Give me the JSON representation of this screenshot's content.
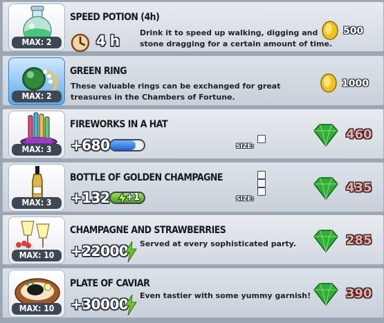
{
  "items": [
    {
      "title": "SPEED POTION (4h)",
      "max": "MAX: 2",
      "duration": "4 h",
      "description": "Drink it to speed up walking, digging and\nstone dragging for a certain amount of time.",
      "price": "500",
      "currency": "coin",
      "image": "potion-flask-icon"
    },
    {
      "title": "GREEN RING",
      "max": "MAX: 2",
      "description": "These valuable rings can be exchanged for great\ntreasures in the Chambers of Fortune.",
      "price": "1000",
      "currency": "coin",
      "image": "green-ring-icon"
    },
    {
      "title": "FIREWORKS IN A HAT",
      "max": "MAX: 3",
      "value": "+680",
      "bar_fill": 0.75,
      "size_label": "SIZE:",
      "size_cells": 1,
      "price": "460",
      "currency": "gem",
      "image": "fireworks-hat-icon"
    },
    {
      "title": "BOTTLE OF GOLDEN CHAMPAGNE",
      "max": "MAX: 3",
      "value": "+132",
      "energy_bonus": "+1",
      "size_label": "SIZE:",
      "size_cells": 3,
      "price": "435",
      "currency": "gem",
      "image": "champagne-bottle-icon"
    },
    {
      "title": "CHAMPAGNE AND STRAWBERRIES",
      "max": "MAX: 10",
      "value": "+22000",
      "description": "Served at every sophisticated party.",
      "price": "285",
      "currency": "gem",
      "image": "champagne-strawberries-icon"
    },
    {
      "title": "PLATE OF CAVIAR",
      "max": "MAX: 10",
      "value": "+30000",
      "description": "Even tastier with some yummy garnish!",
      "price": "390",
      "currency": "gem",
      "image": "caviar-plate-icon"
    }
  ],
  "colors": {
    "gem": "#2fae3a",
    "coin": "#f1c21b",
    "price_gem_text": "#f3a6a6",
    "energy": "#6cc62a",
    "bar": "#1f66d1",
    "badge": "#3e4855"
  }
}
